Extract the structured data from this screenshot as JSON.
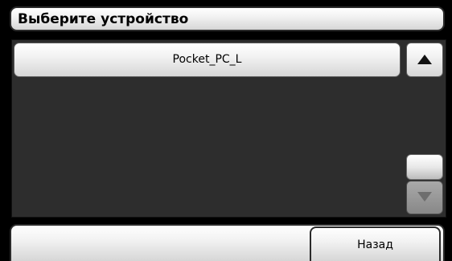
{
  "title": "Выберите устройство",
  "devices": [
    {
      "label": "Pocket_PC_L",
      "selected": true
    }
  ],
  "scroll": {
    "up_icon": "triangle-up-icon",
    "down_icon": "triangle-down-icon",
    "down_enabled": false
  },
  "footer": {
    "back_label": "Назад"
  },
  "colors": {
    "background": "#000000",
    "list_background": "#2d2d2d",
    "button_light": "#ffffff",
    "button_dark": "#d6d6d6"
  }
}
